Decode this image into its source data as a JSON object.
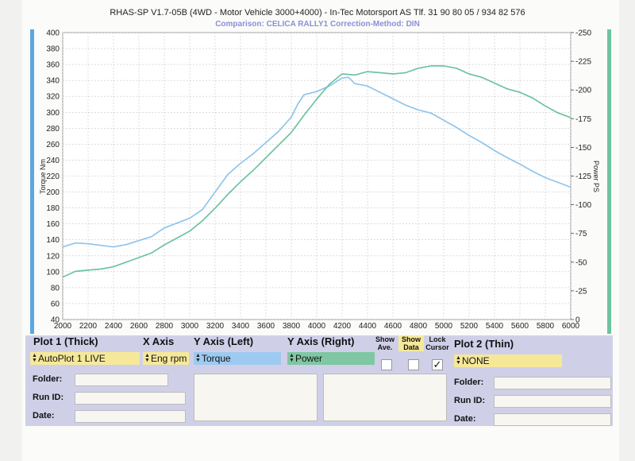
{
  "header": {
    "title": "RHAS-SP V1.7-05B   (4WD - Motor Vehicle 3000+4000) - In-Tec Motorsport AS Tlf. 31 90 80 05 / 934 82 576",
    "subtitle": "Comparison: CELICA RALLY1   Correction-Method: DIN"
  },
  "chart_data": {
    "type": "line",
    "xlabel": "",
    "ylabel": "Torque Nm",
    "y2label": "Power PS",
    "xlim": [
      2000,
      6000
    ],
    "ylim": [
      40,
      400
    ],
    "y2lim": [
      0,
      250
    ],
    "xticks": [
      "2000",
      "2200",
      "2400",
      "2600",
      "2800",
      "3000",
      "3200",
      "3400",
      "3600",
      "3800",
      "4000",
      "4200",
      "4400",
      "4600",
      "4800",
      "5000",
      "5200",
      "5400",
      "5600",
      "5800",
      "6000"
    ],
    "yticks": [
      "40",
      "60",
      "80",
      "100",
      "120",
      "140",
      "160",
      "180",
      "200",
      "220",
      "240",
      "260",
      "280",
      "300",
      "320",
      "340",
      "360",
      "380",
      "400"
    ],
    "y2ticks": [
      "0",
      "25",
      "50",
      "75",
      "100",
      "125",
      "150",
      "175",
      "200",
      "225",
      "250"
    ],
    "grid": true,
    "series": [
      {
        "key": "torque",
        "axis": "left",
        "color": "#8fc5ec",
        "x": [
          2000,
          2100,
          2200,
          2300,
          2400,
          2500,
          2600,
          2700,
          2800,
          2900,
          3000,
          3100,
          3200,
          3300,
          3400,
          3500,
          3600,
          3700,
          3800,
          3850,
          3900,
          4000,
          4100,
          4150,
          4200,
          4250,
          4300,
          4400,
          4500,
          4600,
          4700,
          4800,
          4900,
          5000,
          5100,
          5200,
          5300,
          5400,
          5500,
          5600,
          5700,
          5800,
          5900,
          6000
        ],
        "y": [
          131,
          136,
          135,
          133,
          131,
          134,
          139,
          144,
          155,
          161,
          167,
          178,
          200,
          222,
          236,
          248,
          262,
          276,
          294,
          310,
          322,
          326,
          333,
          338,
          343,
          344,
          336,
          333,
          325,
          317,
          309,
          303,
          299,
          290,
          281,
          271,
          262,
          252,
          243,
          235,
          226,
          218,
          212,
          206
        ]
      },
      {
        "key": "power",
        "axis": "right",
        "color": "#6dc4a0",
        "x": [
          2000,
          2100,
          2200,
          2300,
          2400,
          2500,
          2600,
          2700,
          2800,
          2900,
          3000,
          3100,
          3200,
          3300,
          3400,
          3500,
          3600,
          3700,
          3800,
          3900,
          4000,
          4100,
          4200,
          4300,
          4400,
          4500,
          4600,
          4700,
          4800,
          4900,
          5000,
          5100,
          5200,
          5300,
          5400,
          5500,
          5600,
          5700,
          5800,
          5900,
          6000
        ],
        "y": [
          37,
          42,
          43,
          44,
          46,
          50,
          54,
          58,
          65,
          71,
          77,
          86,
          97,
          109,
          120,
          130,
          141,
          152,
          163,
          178,
          192,
          205,
          214,
          213,
          216,
          215,
          214,
          215,
          219,
          221,
          221,
          219,
          214,
          211,
          206,
          201,
          198,
          193,
          186,
          180,
          176
        ]
      }
    ]
  },
  "panel": {
    "plot1": {
      "title": "Plot 1 (Thick)",
      "value": "AutoPlot 1 LIVE"
    },
    "xaxis": {
      "title": "X Axis",
      "value": "Eng rpm"
    },
    "yleft": {
      "title": "Y Axis (Left)",
      "value": "Torque"
    },
    "yright": {
      "title": "Y Axis (Right)",
      "value": "Power"
    },
    "show_ave": "Show Ave.",
    "show_data": "Show Data",
    "lock_cursor": "Lock Cursor",
    "plot2": {
      "title": "Plot 2 (Thin)",
      "value": "NONE"
    },
    "folder_label": "Folder:",
    "runid_label": "Run ID:",
    "date_label": "Date:",
    "folder2_label": "Folder:",
    "runid2_label": "Run ID:",
    "date2_label": "Date:",
    "checked_mark": "✓",
    "colors": {
      "yellow": "#f6e899",
      "blue": "#9dcaf0",
      "green": "#7fc7a2",
      "panel": "#cfd0e8"
    }
  }
}
